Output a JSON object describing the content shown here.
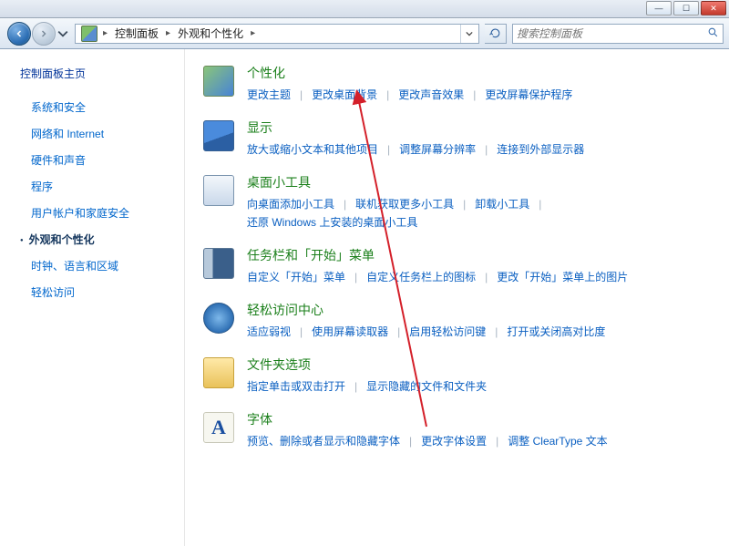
{
  "window": {
    "app_icon": "control-panel",
    "buttons": {
      "min": "—",
      "max": "☐",
      "close": "✕"
    }
  },
  "nav": {
    "crumbs": [
      "控制面板",
      "外观和个性化"
    ],
    "search_placeholder": "搜索控制面板"
  },
  "sidebar": {
    "title": "控制面板主页",
    "items": [
      {
        "label": "系统和安全",
        "active": false
      },
      {
        "label": "网络和 Internet",
        "active": false
      },
      {
        "label": "硬件和声音",
        "active": false
      },
      {
        "label": "程序",
        "active": false
      },
      {
        "label": "用户帐户和家庭安全",
        "active": false
      },
      {
        "label": "外观和个性化",
        "active": true
      },
      {
        "label": "时钟、语言和区域",
        "active": false
      },
      {
        "label": "轻松访问",
        "active": false
      }
    ]
  },
  "categories": [
    {
      "icon": "personalize",
      "title": "个性化",
      "tasks": [
        "更改主题",
        "更改桌面背景",
        "更改声音效果",
        "更改屏幕保护程序"
      ]
    },
    {
      "icon": "display",
      "title": "显示",
      "tasks": [
        "放大或缩小文本和其他项目",
        "调整屏幕分辨率",
        "连接到外部显示器"
      ]
    },
    {
      "icon": "gadgets",
      "title": "桌面小工具",
      "tasks": [
        "向桌面添加小工具",
        "联机获取更多小工具",
        "卸载小工具",
        "还原 Windows 上安装的桌面小工具"
      ]
    },
    {
      "icon": "taskbar",
      "title": "任务栏和「开始」菜单",
      "tasks": [
        "自定义「开始」菜单",
        "自定义任务栏上的图标",
        "更改「开始」菜单上的图片"
      ]
    },
    {
      "icon": "ease",
      "title": "轻松访问中心",
      "tasks": [
        "适应弱视",
        "使用屏幕读取器",
        "启用轻松访问键",
        "打开或关闭高对比度"
      ]
    },
    {
      "icon": "folder",
      "title": "文件夹选项",
      "tasks": [
        "指定单击或双击打开",
        "显示隐藏的文件和文件夹"
      ]
    },
    {
      "icon": "fonts",
      "title": "字体",
      "tasks": [
        "预览、删除或者显示和隐藏字体",
        "更改字体设置",
        "调整 ClearType 文本"
      ]
    }
  ]
}
